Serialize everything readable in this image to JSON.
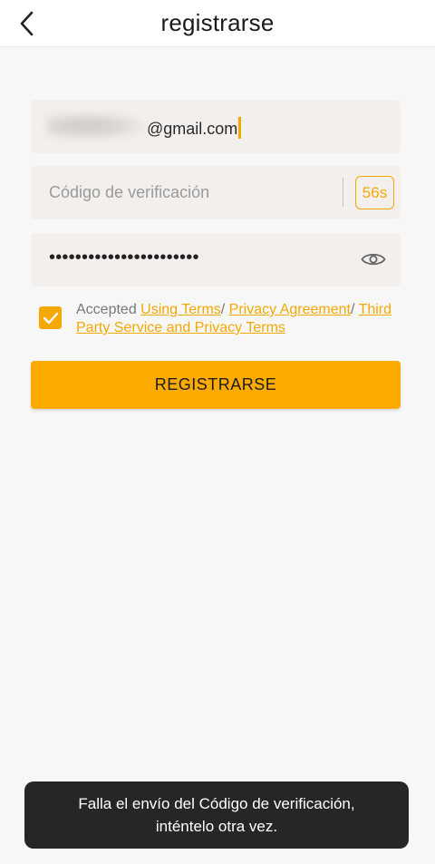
{
  "header": {
    "title": "registrarse",
    "back_icon": "chevron-left-icon"
  },
  "form": {
    "email_value": "@gmail.com",
    "code_placeholder": "Código de verificación",
    "countdown": "56s",
    "password_masked": "•••••••••••••••••••••••",
    "eye_icon": "eye-icon"
  },
  "terms": {
    "checked": true,
    "prefix": "Accepted ",
    "link1": "Using Terms",
    "sep1": "/ ",
    "link2": "Privacy Agreement",
    "sep2": "/ ",
    "link3": "Third Party Service and Privacy Terms"
  },
  "register_button": "REGISTRARSE",
  "toast": {
    "line1": "Falla el envío del Código de verificación,",
    "line2": "inténtelo otra vez."
  },
  "colors": {
    "accent": "#f5a800",
    "button": "#fdab00",
    "field_bg": "#f3efec",
    "toast_bg": "#262626"
  }
}
